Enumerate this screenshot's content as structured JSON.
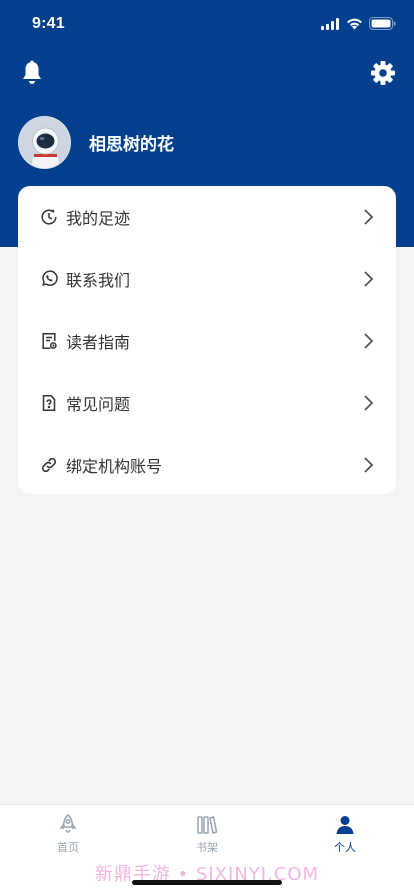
{
  "status_bar": {
    "time": "9:41"
  },
  "header": {
    "bell_icon": "bell-icon",
    "settings_icon": "gear-icon",
    "username": "相思树的花",
    "background_color": "#023f8c"
  },
  "menu": {
    "items": [
      {
        "label": "我的足迹",
        "icon": "history-clock-icon"
      },
      {
        "label": "联系我们",
        "icon": "chat-phone-icon"
      },
      {
        "label": "读者指南",
        "icon": "guide-document-icon"
      },
      {
        "label": "常见问题",
        "icon": "question-file-icon"
      },
      {
        "label": "绑定机构账号",
        "icon": "link-icon"
      }
    ]
  },
  "tabbar": {
    "tabs": [
      {
        "label": "首页",
        "icon": "rocket-home-icon",
        "active": false
      },
      {
        "label": "书架",
        "icon": "bookshelf-icon",
        "active": false
      },
      {
        "label": "个人",
        "icon": "person-icon",
        "active": true
      }
    ],
    "active_color": "#023f8c",
    "inactive_color": "#9aa5b4"
  },
  "watermark": "新鼎手游 • SIXINYI.COM"
}
